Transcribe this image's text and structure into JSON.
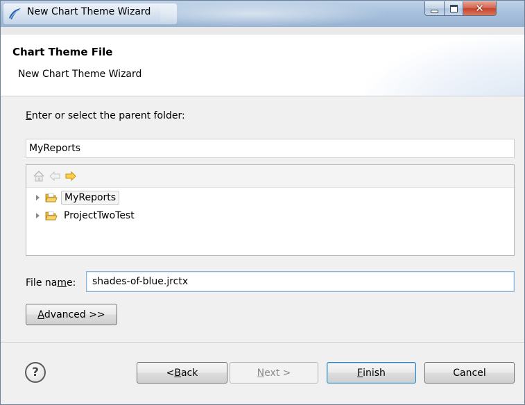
{
  "window": {
    "title": "New Chart Theme Wizard"
  },
  "header": {
    "title": "Chart Theme File",
    "description": "New Chart Theme Wizard"
  },
  "folder": {
    "label_mnemonic": "E",
    "label_rest": "nter or select the parent folder:",
    "value": "MyReports"
  },
  "tree": {
    "items": [
      {
        "label": "MyReports",
        "selected": true
      },
      {
        "label": "ProjectTwoTest",
        "selected": false
      }
    ]
  },
  "file_name": {
    "label_pre": "File na",
    "label_mnemonic": "m",
    "label_post": "e:",
    "value": "shades-of-blue.jrctx"
  },
  "buttons": {
    "advanced_mnemonic": "A",
    "advanced_rest": "dvanced >>",
    "back_pre": "< ",
    "back_mnemonic": "B",
    "back_rest": "ack",
    "next_mnemonic": "N",
    "next_rest": "ext >",
    "finish_mnemonic": "F",
    "finish_rest": "inish",
    "cancel": "Cancel"
  },
  "help": {
    "glyph": "?"
  },
  "icons": {
    "app": "eclipse-app-icon",
    "home": "home-icon",
    "back_arrow": "back-arrow-icon",
    "forward_arrow": "forward-arrow-icon",
    "folder": "open-folder-icon"
  },
  "colors": {
    "accent": "#3c7fb1",
    "folder_yellow": "#f3c34a",
    "arrow_orange": "#f0b020"
  }
}
